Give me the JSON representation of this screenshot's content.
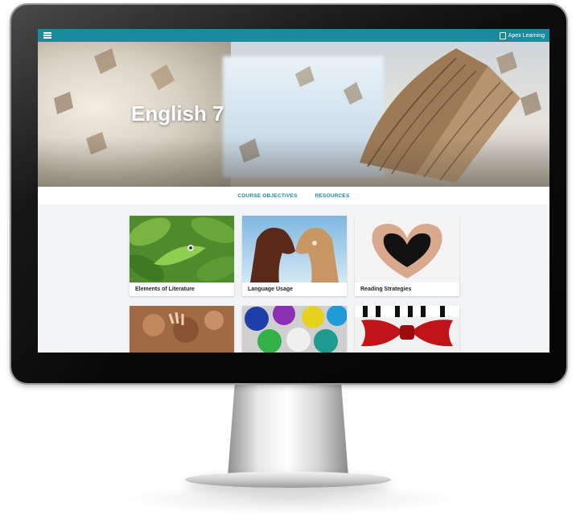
{
  "app": {
    "brand_name": "Apex Learning"
  },
  "course": {
    "title": "English 7"
  },
  "tabs": [
    {
      "label": "COURSE OBJECTIVES"
    },
    {
      "label": "RESOURCES"
    }
  ],
  "units": [
    {
      "label": "Elements of Literature",
      "image": "lizard-in-leaves"
    },
    {
      "label": "Language Usage",
      "image": "carved-horse-heads"
    },
    {
      "label": "Reading Strategies",
      "image": "hands-forming-heart"
    },
    {
      "label": "",
      "image": "cave-handprints"
    },
    {
      "label": "",
      "image": "paint-cans"
    },
    {
      "label": "",
      "image": "red-bow-tie-piano"
    }
  ],
  "icons": {
    "menu": "hamburger-menu-icon",
    "brand": "apex-logo-icon"
  },
  "colors": {
    "accent": "#1b8a9c",
    "background": "#f2f4f5"
  }
}
